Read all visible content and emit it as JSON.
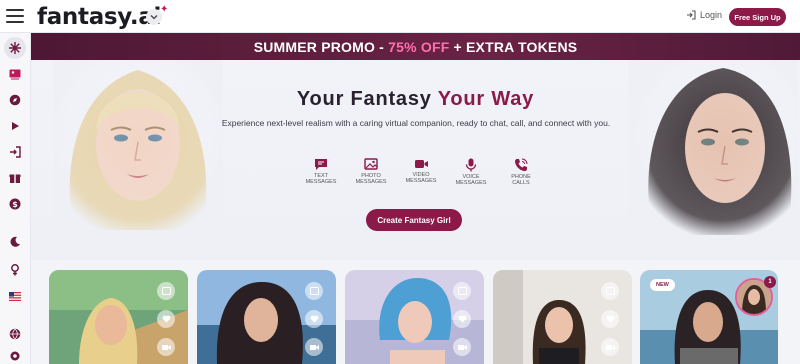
{
  "brand": {
    "name": "fantasy.ai",
    "accent_color": "#8c1a49",
    "pink": "#e75d9c"
  },
  "header": {
    "menu_icon": "hamburger-icon",
    "chevron_icon": "chevron-down-icon",
    "login_label": "Login",
    "signup_label": "Free Sign Up"
  },
  "sidebar": {
    "items": [
      {
        "icon": "sparkle-icon",
        "active": true
      },
      {
        "icon": "gallery-icon"
      },
      {
        "icon": "compass-icon"
      },
      {
        "icon": "play-icon"
      },
      {
        "icon": "login-icon"
      },
      {
        "icon": "gift-icon"
      },
      {
        "icon": "dollar-icon"
      },
      {
        "icon": "moon-icon"
      },
      {
        "icon": "female-icon"
      },
      {
        "icon": "us-flag-icon"
      },
      {
        "icon": "globe-icon"
      },
      {
        "icon": "settings-icon"
      }
    ]
  },
  "promo": {
    "prefix": "SUMMER PROMO - ",
    "percent": "75% OFF",
    "suffix": " + EXTRA TOKENS"
  },
  "hero": {
    "title_main": "Your Fantasy ",
    "title_accent": "Your Way",
    "subtitle": "Experience next-level realism with a caring virtual companion, ready to chat, call, and connect with you.",
    "features": [
      {
        "icon": "chat-icon",
        "line1": "TEXT",
        "line2": "MESSAGES"
      },
      {
        "icon": "image-icon",
        "line1": "PHOTO",
        "line2": "MESSAGES"
      },
      {
        "icon": "video-icon",
        "line1": "VIDEO",
        "line2": "MESSAGES"
      },
      {
        "icon": "microphone-icon",
        "line1": "VOICE",
        "line2": "MESSAGES"
      },
      {
        "icon": "phone-icon",
        "line1": "PHONE",
        "line2": "CALLS"
      }
    ],
    "cta_label": "Create Fantasy Girl"
  },
  "cards": [
    {
      "badge": "",
      "photo": "blonde woman on beach"
    },
    {
      "badge": "",
      "photo": "brunette woman on boat"
    },
    {
      "badge": "",
      "photo": "blue-haired woman"
    },
    {
      "badge": "",
      "photo": "brunette woman selfie"
    },
    {
      "badge": "NEW",
      "photo": "tattooed woman by pool",
      "story_count": "1"
    }
  ]
}
